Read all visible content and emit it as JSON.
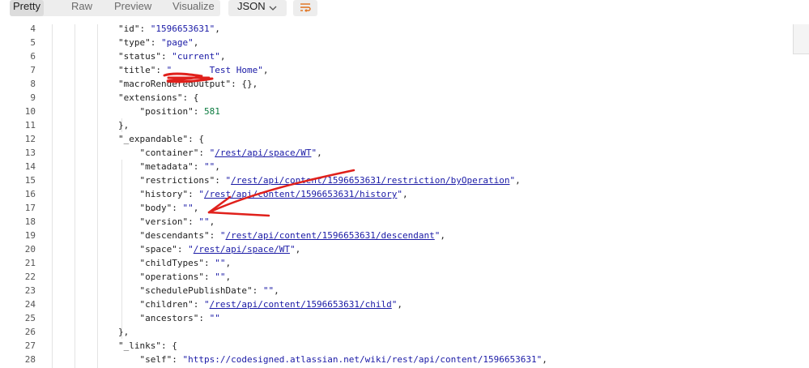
{
  "toolbar": {
    "tabs": [
      "Pretty",
      "Raw",
      "Preview",
      "Visualize"
    ],
    "active_tab": "Pretty",
    "format": "JSON",
    "chevron_icon": "chevron-down-icon",
    "wrap_icon": "wrap-lines-icon"
  },
  "editor": {
    "lines": [
      {
        "n": "4",
        "tokens": [
          [
            "k",
            "\"id\""
          ],
          [
            "p",
            ": "
          ],
          [
            "s",
            "\"1596653631\""
          ],
          [
            "p",
            ","
          ]
        ]
      },
      {
        "n": "5",
        "tokens": [
          [
            "k",
            "\"type\""
          ],
          [
            "p",
            ": "
          ],
          [
            "s",
            "\"page\""
          ],
          [
            "p",
            ","
          ]
        ]
      },
      {
        "n": "6",
        "tokens": [
          [
            "k",
            "\"status\""
          ],
          [
            "p",
            ": "
          ],
          [
            "s",
            "\"current\""
          ],
          [
            "p",
            ","
          ]
        ]
      },
      {
        "n": "7",
        "tokens": [
          [
            "k",
            "\"title\""
          ],
          [
            "p",
            ": "
          ],
          [
            "s",
            "\"       Test Home\""
          ],
          [
            "p",
            ","
          ]
        ]
      },
      {
        "n": "8",
        "tokens": [
          [
            "k",
            "\"macroRenderedOutput\""
          ],
          [
            "p",
            ": {},"
          ]
        ]
      },
      {
        "n": "9",
        "tokens": [
          [
            "k",
            "\"extensions\""
          ],
          [
            "p",
            ": {"
          ]
        ]
      },
      {
        "n": "10",
        "tokens": [
          [
            "p",
            "    "
          ],
          [
            "k",
            "\"position\""
          ],
          [
            "p",
            ": "
          ],
          [
            "n",
            "581"
          ]
        ]
      },
      {
        "n": "11",
        "tokens": [
          [
            "p",
            "},"
          ]
        ]
      },
      {
        "n": "12",
        "tokens": [
          [
            "k",
            "\"_expandable\""
          ],
          [
            "p",
            ": {"
          ]
        ]
      },
      {
        "n": "13",
        "tokens": [
          [
            "p",
            "    "
          ],
          [
            "k",
            "\"container\""
          ],
          [
            "p",
            ": "
          ],
          [
            "s",
            "\""
          ],
          [
            "l",
            "/rest/api/space/WT"
          ],
          [
            "s",
            "\""
          ],
          [
            "p",
            ","
          ]
        ]
      },
      {
        "n": "14",
        "tokens": [
          [
            "p",
            "    "
          ],
          [
            "k",
            "\"metadata\""
          ],
          [
            "p",
            ": "
          ],
          [
            "s",
            "\"\""
          ],
          [
            "p",
            ","
          ]
        ]
      },
      {
        "n": "15",
        "tokens": [
          [
            "p",
            "    "
          ],
          [
            "k",
            "\"restrictions\""
          ],
          [
            "p",
            ": "
          ],
          [
            "s",
            "\""
          ],
          [
            "l",
            "/rest/api/content/1596653631/restriction/byOperation"
          ],
          [
            "s",
            "\""
          ],
          [
            "p",
            ","
          ]
        ]
      },
      {
        "n": "16",
        "tokens": [
          [
            "p",
            "    "
          ],
          [
            "k",
            "\"history\""
          ],
          [
            "p",
            ": "
          ],
          [
            "s",
            "\""
          ],
          [
            "l",
            "/rest/api/content/1596653631/history"
          ],
          [
            "s",
            "\""
          ],
          [
            "p",
            ","
          ]
        ]
      },
      {
        "n": "17",
        "tokens": [
          [
            "p",
            "    "
          ],
          [
            "k",
            "\"body\""
          ],
          [
            "p",
            ": "
          ],
          [
            "s",
            "\"\""
          ],
          [
            "p",
            ","
          ]
        ]
      },
      {
        "n": "18",
        "tokens": [
          [
            "p",
            "    "
          ],
          [
            "k",
            "\"version\""
          ],
          [
            "p",
            ": "
          ],
          [
            "s",
            "\"\""
          ],
          [
            "p",
            ","
          ]
        ]
      },
      {
        "n": "19",
        "tokens": [
          [
            "p",
            "    "
          ],
          [
            "k",
            "\"descendants\""
          ],
          [
            "p",
            ": "
          ],
          [
            "s",
            "\""
          ],
          [
            "l",
            "/rest/api/content/1596653631/descendant"
          ],
          [
            "s",
            "\""
          ],
          [
            "p",
            ","
          ]
        ]
      },
      {
        "n": "20",
        "tokens": [
          [
            "p",
            "    "
          ],
          [
            "k",
            "\"space\""
          ],
          [
            "p",
            ": "
          ],
          [
            "s",
            "\""
          ],
          [
            "l",
            "/rest/api/space/WT"
          ],
          [
            "s",
            "\""
          ],
          [
            "p",
            ","
          ]
        ]
      },
      {
        "n": "21",
        "tokens": [
          [
            "p",
            "    "
          ],
          [
            "k",
            "\"childTypes\""
          ],
          [
            "p",
            ": "
          ],
          [
            "s",
            "\"\""
          ],
          [
            "p",
            ","
          ]
        ]
      },
      {
        "n": "22",
        "tokens": [
          [
            "p",
            "    "
          ],
          [
            "k",
            "\"operations\""
          ],
          [
            "p",
            ": "
          ],
          [
            "s",
            "\"\""
          ],
          [
            "p",
            ","
          ]
        ]
      },
      {
        "n": "23",
        "tokens": [
          [
            "p",
            "    "
          ],
          [
            "k",
            "\"schedulePublishDate\""
          ],
          [
            "p",
            ": "
          ],
          [
            "s",
            "\"\""
          ],
          [
            "p",
            ","
          ]
        ]
      },
      {
        "n": "24",
        "tokens": [
          [
            "p",
            "    "
          ],
          [
            "k",
            "\"children\""
          ],
          [
            "p",
            ": "
          ],
          [
            "s",
            "\""
          ],
          [
            "l",
            "/rest/api/content/1596653631/child"
          ],
          [
            "s",
            "\""
          ],
          [
            "p",
            ","
          ]
        ]
      },
      {
        "n": "25",
        "tokens": [
          [
            "p",
            "    "
          ],
          [
            "k",
            "\"ancestors\""
          ],
          [
            "p",
            ": "
          ],
          [
            "s",
            "\"\""
          ]
        ]
      },
      {
        "n": "26",
        "tokens": [
          [
            "p",
            "},"
          ]
        ]
      },
      {
        "n": "27",
        "tokens": [
          [
            "k",
            "\"_links\""
          ],
          [
            "p",
            ": {"
          ]
        ]
      },
      {
        "n": "28",
        "tokens": [
          [
            "p",
            "    "
          ],
          [
            "k",
            "\"self\""
          ],
          [
            "p",
            ": "
          ],
          [
            "s",
            "\"https://codesigned.atlassian.net/wiki/rest/api/content/1596653631\""
          ],
          [
            "p",
            ","
          ]
        ]
      }
    ]
  },
  "colors": {
    "string": "#1a1aa6",
    "number": "#0b7a3f",
    "annotation": "#e0201b"
  }
}
